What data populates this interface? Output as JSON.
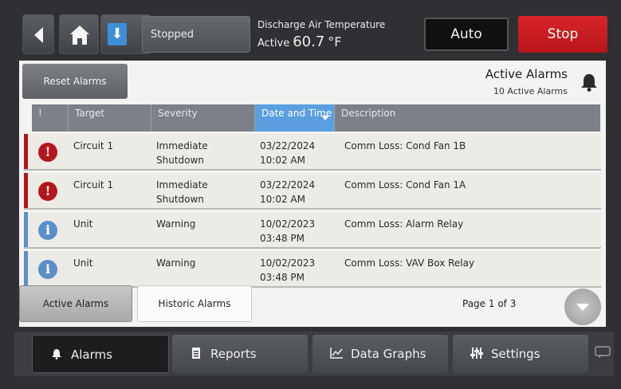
{
  "topbar": {
    "status_label": "Stopped",
    "temp_label": "Discharge Air Temperature",
    "temp_state": "Active",
    "temp_value": "60.7",
    "temp_unit": "°F",
    "auto_label": "Auto",
    "stop_label": "Stop"
  },
  "panel": {
    "reset_label": "Reset Alarms",
    "title": "Active Alarms",
    "count": "10 Active Alarms",
    "columns": {
      "flag": "!",
      "target": "Target",
      "severity": "Severity",
      "date": "Date and Time",
      "description": "Description"
    },
    "rows": [
      {
        "type": "error",
        "target": "Circuit 1",
        "severity_line1": "Immediate",
        "severity_line2": "Shutdown",
        "date": "03/22/2024",
        "time": "10:02 AM",
        "description": "Comm Loss: Cond Fan 1B"
      },
      {
        "type": "error",
        "target": "Circuit 1",
        "severity_line1": "Immediate",
        "severity_line2": "Shutdown",
        "date": "03/22/2024",
        "time": "10:02 AM",
        "description": "Comm Loss: Cond Fan 1A"
      },
      {
        "type": "info",
        "target": "Unit",
        "severity_line1": "Warning",
        "severity_line2": "",
        "date": "10/02/2023",
        "time": "03:48 PM",
        "description": "Comm Loss: Alarm Relay"
      },
      {
        "type": "info",
        "target": "Unit",
        "severity_line1": "Warning",
        "severity_line2": "",
        "date": "10/02/2023",
        "time": "03:48 PM",
        "description": "Comm Loss: VAV Box Relay"
      }
    ],
    "tabs": {
      "active": "Active Alarms",
      "historic": "Historic Alarms"
    },
    "page": "Page 1 of 3"
  },
  "nav": {
    "alarms": "Alarms",
    "reports": "Reports",
    "graphs": "Data Graphs",
    "settings": "Settings"
  },
  "colors": {
    "stop": "#c8191f",
    "accent": "#3d8fd8",
    "error": "#b3171d",
    "info": "#5b8fc7"
  },
  "icons": {
    "back": "back-arrow-icon",
    "home": "home-icon",
    "download": "down-arrow-icon",
    "bell": "bell-icon",
    "error": "alert-error-icon",
    "info": "info-icon",
    "page_down": "chevron-down-icon",
    "alarms": "bell-icon",
    "reports": "document-icon",
    "graphs": "chart-icon",
    "settings": "sliders-icon",
    "chat": "chat-icon"
  }
}
